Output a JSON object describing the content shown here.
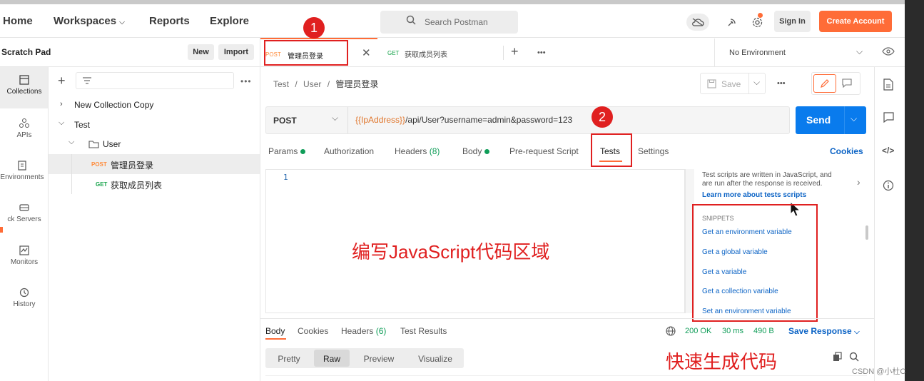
{
  "nav": {
    "home": "Home",
    "workspaces": "Workspaces",
    "reports": "Reports",
    "explore": "Explore"
  },
  "search": {
    "placeholder": "Search Postman"
  },
  "auth": {
    "sign_in": "Sign In",
    "create": "Create Account"
  },
  "sidebar": {
    "title": "Scratch Pad",
    "new": "New",
    "import": "Import",
    "rail": [
      "Collections",
      "APIs",
      "Environments",
      "ck Servers",
      "Monitors",
      "History"
    ],
    "tree": {
      "collection1": "New Collection Copy",
      "collection2": "Test",
      "folder": "User",
      "req1": {
        "method": "POST",
        "name": "管理员登录"
      },
      "req2": {
        "method": "GET",
        "name": "获取成员列表"
      }
    }
  },
  "tabs": [
    {
      "method": "POST",
      "name": "管理员登录"
    },
    {
      "method": "GET",
      "name": "获取成员列表"
    }
  ],
  "environment": "No Environment",
  "breadcrumb": {
    "a": "Test",
    "b": "User",
    "c": "管理员登录",
    "sep": "/"
  },
  "save": "Save",
  "request": {
    "method": "POST",
    "url_var": "{{IpAddress}}",
    "url_rest": "/api/User?username=admin&password=123",
    "send": "Send"
  },
  "subtabs": {
    "params": "Params",
    "auth": "Authorization",
    "headers": "Headers",
    "headers_count": "(8)",
    "body": "Body",
    "prereq": "Pre-request Script",
    "tests": "Tests",
    "settings": "Settings",
    "cookies": "Cookies"
  },
  "editor": {
    "line": "1"
  },
  "info": {
    "line1": "Test scripts are written in JavaScript, and",
    "line2": "are run after the response is received.",
    "learn": "Learn more about tests scripts"
  },
  "snippets": {
    "title": "SNIPPETS",
    "items": [
      "Get an environment variable",
      "Get a global variable",
      "Get a variable",
      "Get a collection variable",
      "Set an environment variable"
    ]
  },
  "annotations": {
    "editor_area": "编写JavaScript代码区域",
    "quick_gen": "快速生成代码",
    "n1": "1",
    "n2": "2"
  },
  "response": {
    "tabs": {
      "body": "Body",
      "cookies": "Cookies",
      "headers": "Headers",
      "headers_count": "(6)",
      "results": "Test Results"
    },
    "status": "200 OK",
    "time": "30 ms",
    "size": "490 B",
    "save": "Save Response",
    "views": [
      "Pretty",
      "Raw",
      "Preview",
      "Visualize"
    ]
  },
  "watermark": "CSDN @小杜C",
  "colors": {
    "accent": "#ff6c37",
    "send": "#097bed",
    "annotation": "#e02020"
  }
}
